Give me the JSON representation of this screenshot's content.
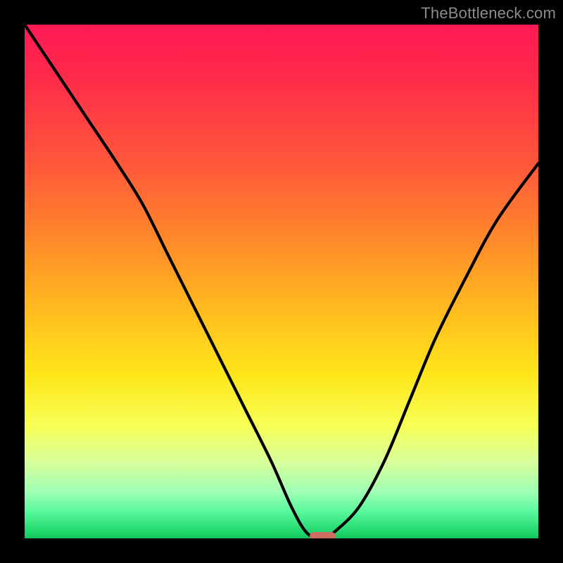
{
  "watermark": "TheBottleneck.com",
  "colors": {
    "gradient_top": "#ff1a55",
    "gradient_mid_upper": "#ff8a2a",
    "gradient_mid": "#ffe61a",
    "gradient_lower": "#9fffb5",
    "gradient_bottom": "#13c25c",
    "curve": "#000000",
    "marker": "#cc6f62",
    "frame": "#000000"
  },
  "chart_data": {
    "type": "line",
    "title": "",
    "xlabel": "",
    "ylabel": "",
    "xlim": [
      0,
      100
    ],
    "ylim": [
      0,
      100
    ],
    "x": [
      0,
      6,
      12,
      18,
      23,
      28,
      33,
      38,
      43,
      48,
      52,
      55,
      58,
      60,
      65,
      70,
      75,
      80,
      86,
      92,
      100
    ],
    "values": [
      100,
      91,
      82,
      73,
      65,
      55,
      45,
      35,
      25,
      15,
      6,
      1,
      0,
      1,
      6,
      15,
      27,
      39,
      51,
      62,
      73
    ],
    "min_point_x": 58,
    "min_point_y": 0,
    "marker": {
      "x": 58,
      "y": 0,
      "width_pct": 5
    },
    "background_gradient": [
      "#ff1a55",
      "#ff8a2a",
      "#ffe61a",
      "#9fffb5",
      "#13c25c"
    ]
  }
}
